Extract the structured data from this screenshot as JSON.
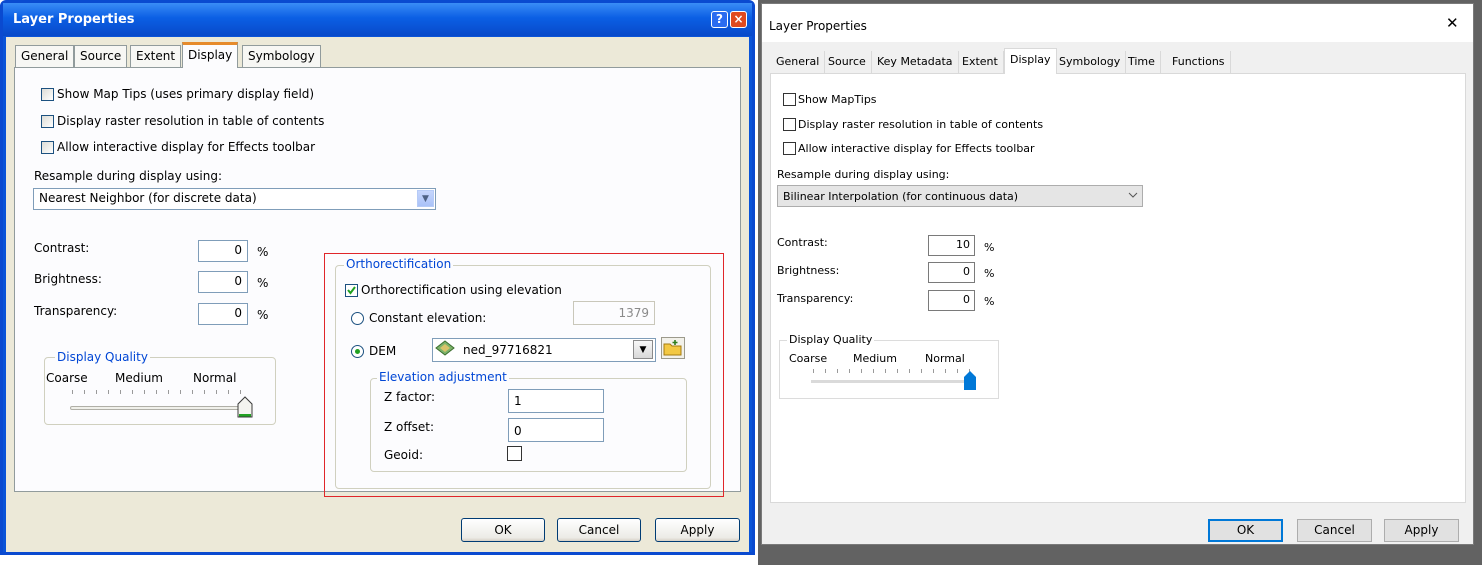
{
  "left": {
    "title": "Layer Properties",
    "title_buttons": [
      {
        "icon": "help-icon",
        "glyph": "?"
      },
      {
        "icon": "close-icon",
        "glyph": "×"
      }
    ],
    "tabs": [
      "General",
      "Source",
      "Extent",
      "Display",
      "Symbology"
    ],
    "selected_tab": "Display",
    "checkboxes": [
      {
        "label": "Show Map Tips (uses primary display field)",
        "checked": false
      },
      {
        "label": "Display raster resolution in table of contents",
        "checked": false
      },
      {
        "label": "Allow interactive display for Effects toolbar",
        "checked": false
      }
    ],
    "resample_label": "Resample during display using:",
    "resample_value": "Nearest Neighbor (for discrete data)",
    "contrast": {
      "label": "Contrast:",
      "value": "0",
      "unit": "%"
    },
    "brightness": {
      "label": "Brightness:",
      "value": "0",
      "unit": "%"
    },
    "transparency": {
      "label": "Transparency:",
      "value": "0",
      "unit": "%"
    },
    "display_quality": {
      "title": "Display Quality",
      "coarse": "Coarse",
      "medium": "Medium",
      "normal": "Normal",
      "level": 1.0
    },
    "ortho": {
      "title": "Orthorectification",
      "use_elevation_label": "Orthorectification using elevation",
      "use_elevation_checked": true,
      "constant_label": "Constant elevation:",
      "constant_value": "1379",
      "dem_label": "DEM",
      "dem_value": "ned_97716821",
      "elev_adj_title": "Elevation adjustment",
      "z_factor_label": "Z factor:",
      "z_factor_value": "1",
      "z_offset_label": "Z offset:",
      "z_offset_value": "0",
      "geoid_label": "Geoid:",
      "highlight_color": "#e0262a"
    },
    "buttons": {
      "ok": "OK",
      "cancel": "Cancel",
      "apply": "Apply"
    }
  },
  "right": {
    "title": "Layer Properties",
    "close_glyph": "✕",
    "tabs": [
      "General",
      "Source",
      "Key Metadata",
      "Extent",
      "Display",
      "Symbology",
      "Time",
      "Functions"
    ],
    "selected_tab": "Display",
    "checkboxes": [
      {
        "label": "Show MapTips",
        "checked": false
      },
      {
        "label": "Display raster resolution in table of contents",
        "checked": false
      },
      {
        "label": "Allow interactive display for Effects toolbar",
        "checked": false
      }
    ],
    "resample_label": "Resample during display using:",
    "resample_value": "Bilinear Interpolation (for continuous data)",
    "contrast": {
      "label": "Contrast:",
      "value": "10",
      "unit": "%"
    },
    "brightness": {
      "label": "Brightness:",
      "value": "0",
      "unit": "%"
    },
    "transparency": {
      "label": "Transparency:",
      "value": "0",
      "unit": "%"
    },
    "display_quality": {
      "title": "Display Quality",
      "coarse": "Coarse",
      "medium": "Medium",
      "normal": "Normal",
      "level": 1.0
    },
    "buttons": {
      "ok": "OK",
      "cancel": "Cancel",
      "apply": "Apply"
    },
    "accent_color": "#0078d7"
  }
}
